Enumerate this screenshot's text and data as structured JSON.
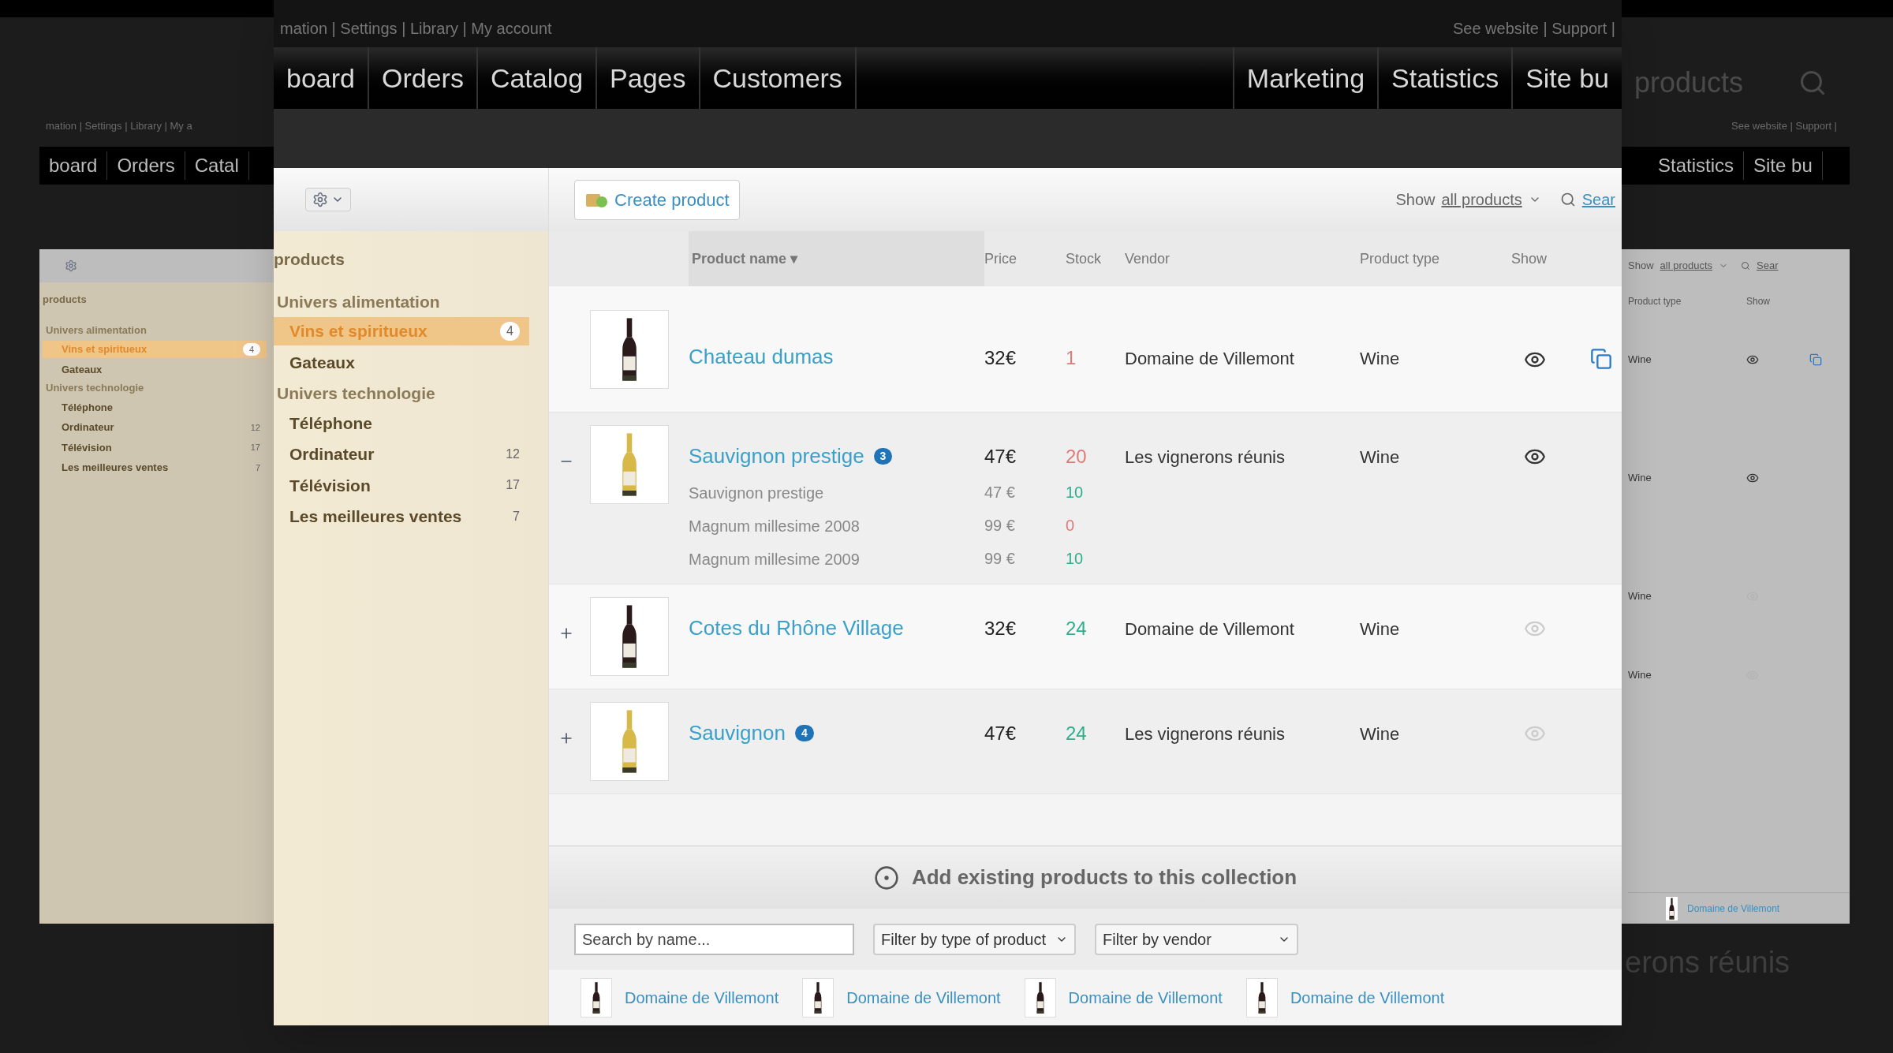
{
  "backdrop": {
    "menu": "products",
    "caption": "erons réunis"
  },
  "ghost_left": {
    "links": "mation | Settings | Library | My a",
    "nav": [
      "board",
      "Orders",
      "Catal"
    ],
    "sidebar": {
      "title": "products",
      "groups": [
        {
          "label": "Univers alimentation",
          "children": [
            {
              "label": "Vins et spiritueux",
              "count": "4",
              "selected": true
            },
            {
              "label": "Gateaux",
              "selected": false
            }
          ]
        },
        {
          "label": "Univers technologie",
          "children": [
            {
              "label": "Téléphone",
              "selected": false
            },
            {
              "label": "Ordinateur",
              "count": "12",
              "selected": false
            },
            {
              "label": "Télévision",
              "count": "17",
              "selected": false
            },
            {
              "label": "Les meilleures ventes",
              "count": "7",
              "selected": false
            }
          ]
        }
      ]
    }
  },
  "ghost_right": {
    "links": "See website | Support |",
    "nav": [
      "Statistics",
      "Site bu"
    ],
    "show_label": "Show",
    "show_link": "all products",
    "search": "Sear",
    "columns": [
      "Product type",
      "Show"
    ],
    "rows": [
      {
        "type": "Wine",
        "visible": true,
        "duplicate": true
      },
      {
        "type": "Wine",
        "visible": true,
        "duplicate": false
      },
      {
        "type": "Wine",
        "visible": false,
        "duplicate": false
      },
      {
        "type": "Wine",
        "visible": false,
        "duplicate": false
      }
    ],
    "result": "Domaine de Villemont"
  },
  "header": {
    "links_left": "mation | Settings | Library | My account",
    "links_right": "See website | Support |",
    "nav_left": [
      "board",
      "Orders",
      "Catalog",
      "Pages",
      "Customers"
    ],
    "nav_right": [
      "Marketing",
      "Statistics",
      "Site bu"
    ]
  },
  "toolbar": {
    "create": "Create product",
    "show_label": "Show",
    "show_link": "all products",
    "search": "Sear"
  },
  "sidebar": {
    "title": "products",
    "groups": [
      {
        "label": "Univers alimentation",
        "children": [
          {
            "label": "Vins et spiritueux",
            "count": "4",
            "selected": true
          },
          {
            "label": "Gateaux",
            "selected": false
          }
        ]
      },
      {
        "label": "Univers technologie",
        "children": [
          {
            "label": "Téléphone",
            "selected": false
          },
          {
            "label": "Ordinateur",
            "count": "12",
            "selected": false
          },
          {
            "label": "Télévision",
            "count": "17",
            "selected": false
          },
          {
            "label": "Les meilleures ventes",
            "count": "7",
            "selected": false
          }
        ]
      }
    ]
  },
  "table": {
    "columns": [
      "Product name",
      "Price",
      "Stock",
      "Vendor",
      "Product type",
      "Show"
    ],
    "sort_mark": "▾",
    "rows": [
      {
        "kind": "single",
        "color": "#2a1a1a",
        "name": "Chateau dumas",
        "price": "32€",
        "stock": "1",
        "low_stock": true,
        "vendor": "Domaine de Villemont",
        "type": "Wine",
        "visible": true,
        "duplicate": true
      },
      {
        "kind": "expanded",
        "color": "#d9b84a",
        "name": "Sauvignon prestige",
        "badge": "3",
        "price": "47€",
        "stock": "20",
        "low_stock": true,
        "vendor": "Les vignerons réunis",
        "type": "Wine",
        "visible": true,
        "duplicate": false,
        "variants": [
          {
            "name": "Sauvignon prestige",
            "price": "47 €",
            "stock": "10",
            "low_stock": false
          },
          {
            "name": "Magnum millesime 2008",
            "price": "99 €",
            "stock": "0",
            "low_stock": true
          },
          {
            "name": "Magnum millesime 2009",
            "price": "99 €",
            "stock": "10",
            "low_stock": false
          }
        ]
      },
      {
        "kind": "collapsed",
        "color": "#2a1a1a",
        "name": "Cotes du Rhône Village",
        "price": "32€",
        "stock": "24",
        "low_stock": false,
        "vendor": "Domaine de Villemont",
        "type": "Wine",
        "visible": false,
        "duplicate": false
      },
      {
        "kind": "collapsed",
        "color": "#d9b84a",
        "name": "Sauvignon",
        "badge": "4",
        "price": "47€",
        "stock": "24",
        "low_stock": false,
        "vendor": "Les vignerons réunis",
        "type": "Wine",
        "visible": false,
        "duplicate": false
      }
    ]
  },
  "add_section": {
    "title": "Add existing products to this collection",
    "search_placeholder": "Search by name...",
    "filters": [
      "Filter by type of product",
      "Filter by vendor"
    ],
    "results": [
      "Domaine de Villemont",
      "Domaine de Villemont",
      "Domaine de Villemont",
      "Domaine de Villemont"
    ]
  }
}
